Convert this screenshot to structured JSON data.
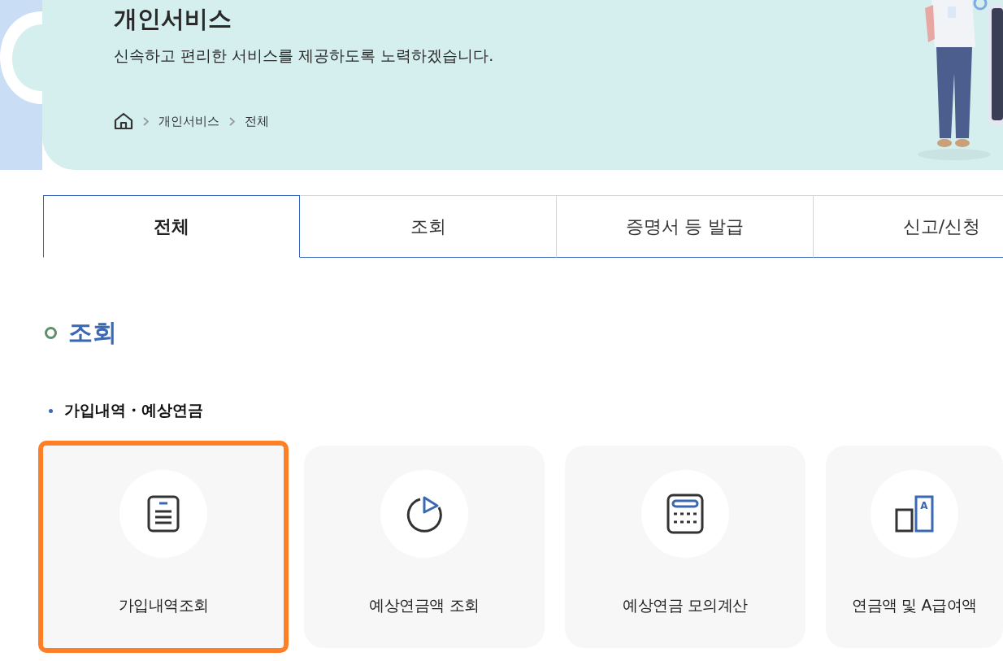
{
  "header": {
    "title": "개인서비스",
    "subtitle": "신속하고 편리한 서비스를 제공하도록 노력하겠습니다.",
    "breadcrumb": [
      "개인서비스",
      "전체"
    ]
  },
  "tabs": [
    {
      "label": "전체",
      "selected": true
    },
    {
      "label": "조회",
      "selected": false
    },
    {
      "label": "증명서 등 발급",
      "selected": false
    },
    {
      "label": "신고/신청",
      "selected": false
    }
  ],
  "section": {
    "title": "조회",
    "subsection": "가입내역・예상연금",
    "cards": [
      {
        "label": "가입내역조회",
        "kind": "document",
        "highlighted": true
      },
      {
        "label": "예상연금액 조회",
        "kind": "pie",
        "highlighted": false
      },
      {
        "label": "예상연금 모의계산",
        "kind": "calculator",
        "highlighted": false
      },
      {
        "label": "연금액 및 A급여액",
        "kind": "compare",
        "icon_text": "A",
        "highlighted": false
      }
    ]
  }
}
